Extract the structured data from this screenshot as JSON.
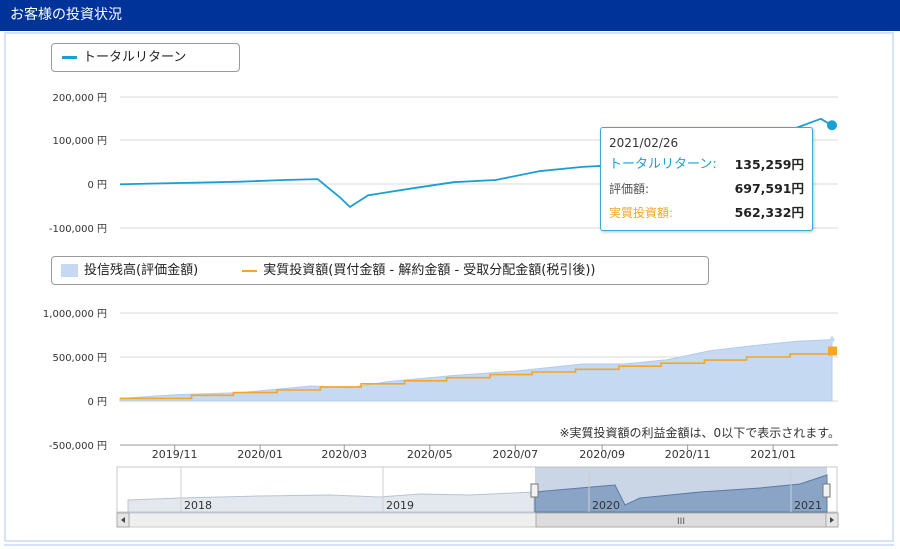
{
  "header": {
    "title": "お客様の投資状況"
  },
  "colors": {
    "header_bg": "#003399",
    "total_return": "#1a9fd0",
    "valuation_fill": "#c6d9f2",
    "investment": "#f5a623"
  },
  "top_legend": {
    "label": "トータルリターン"
  },
  "bottom_legend": {
    "balance_label": "投信残高(評価金額)",
    "investment_label": "実質投資額(買付金額 - 解約金額 - 受取分配金額(税引後))"
  },
  "tooltip": {
    "date": "2021/02/26",
    "total_return_label": "トータルリターン:",
    "total_return_value": "135,259円",
    "valuation_label": "評価額:",
    "valuation_value": "697,591円",
    "investment_label": "実質投資額:",
    "investment_value": "562,332円"
  },
  "note": "※実質投資額の利益金額は、0以下で表示されます。",
  "navigator": {
    "years": [
      "2018",
      "2019",
      "2020",
      "2021"
    ],
    "scroll_label": "III"
  },
  "chart_data": [
    {
      "type": "line",
      "series": [
        {
          "name": "トータルリターン",
          "x": [
            "2019-10-07",
            "2019-11-01",
            "2019-12-01",
            "2020-01-01",
            "2020-02-01",
            "2020-02-25",
            "2020-03-12",
            "2020-03-19",
            "2020-04-01",
            "2020-05-01",
            "2020-06-01",
            "2020-07-01",
            "2020-08-01",
            "2020-09-01",
            "2020-10-01",
            "2020-11-01",
            "2020-11-15",
            "2020-12-01",
            "2021-01-01",
            "2021-02-01",
            "2021-02-18",
            "2021-02-26"
          ],
          "values": [
            0,
            2000,
            4000,
            6000,
            10000,
            12000,
            -30000,
            -52000,
            -25000,
            -10000,
            5000,
            10000,
            30000,
            40000,
            45000,
            60000,
            90000,
            100000,
            110000,
            130000,
            150000,
            135259
          ]
        }
      ],
      "ylabel": "",
      "yticks": [
        "200,000 円",
        "100,000 円",
        "0 円",
        "-100,000 円"
      ],
      "ylim": [
        -100000,
        200000
      ]
    },
    {
      "type": "area",
      "categories": [
        "2019/11",
        "2020/01",
        "2020/03",
        "2020/05",
        "2020/07",
        "2020/09",
        "2020/11",
        "2021/01"
      ],
      "series": [
        {
          "name": "投信残高(評価金額)",
          "x": [
            "2019-10-07",
            "2019-11-15",
            "2020-01-01",
            "2020-02-20",
            "2020-03-19",
            "2020-04-15",
            "2020-06-01",
            "2020-07-15",
            "2020-09-01",
            "2020-10-01",
            "2020-11-01",
            "2020-12-01",
            "2021-01-01",
            "2021-02-01",
            "2021-02-26"
          ],
          "values": [
            30000,
            70000,
            95000,
            170000,
            150000,
            220000,
            290000,
            340000,
            420000,
            420000,
            470000,
            570000,
            630000,
            680000,
            697591
          ]
        },
        {
          "name": "実質投資額(買付金額 - 解約金額 - 受取分配金額(税引後))",
          "x": [
            "2019-10-07",
            "2019-10-27",
            "2019-11-27",
            "2019-12-27",
            "2020-01-27",
            "2020-02-27",
            "2020-03-27",
            "2020-04-27",
            "2020-05-27",
            "2020-06-27",
            "2020-07-27",
            "2020-08-27",
            "2020-09-27",
            "2020-10-27",
            "2020-11-27",
            "2020-12-27",
            "2021-01-27",
            "2021-02-26"
          ],
          "values": [
            30000,
            30000,
            65000,
            95000,
            125000,
            160000,
            195000,
            230000,
            265000,
            300000,
            330000,
            360000,
            395000,
            430000,
            465000,
            500000,
            535000,
            562332
          ]
        }
      ],
      "yticks": [
        "1,000,000 円",
        "500,000 円",
        "0 円",
        "-500,000 円"
      ],
      "ylim": [
        -500000,
        1000000
      ]
    }
  ]
}
